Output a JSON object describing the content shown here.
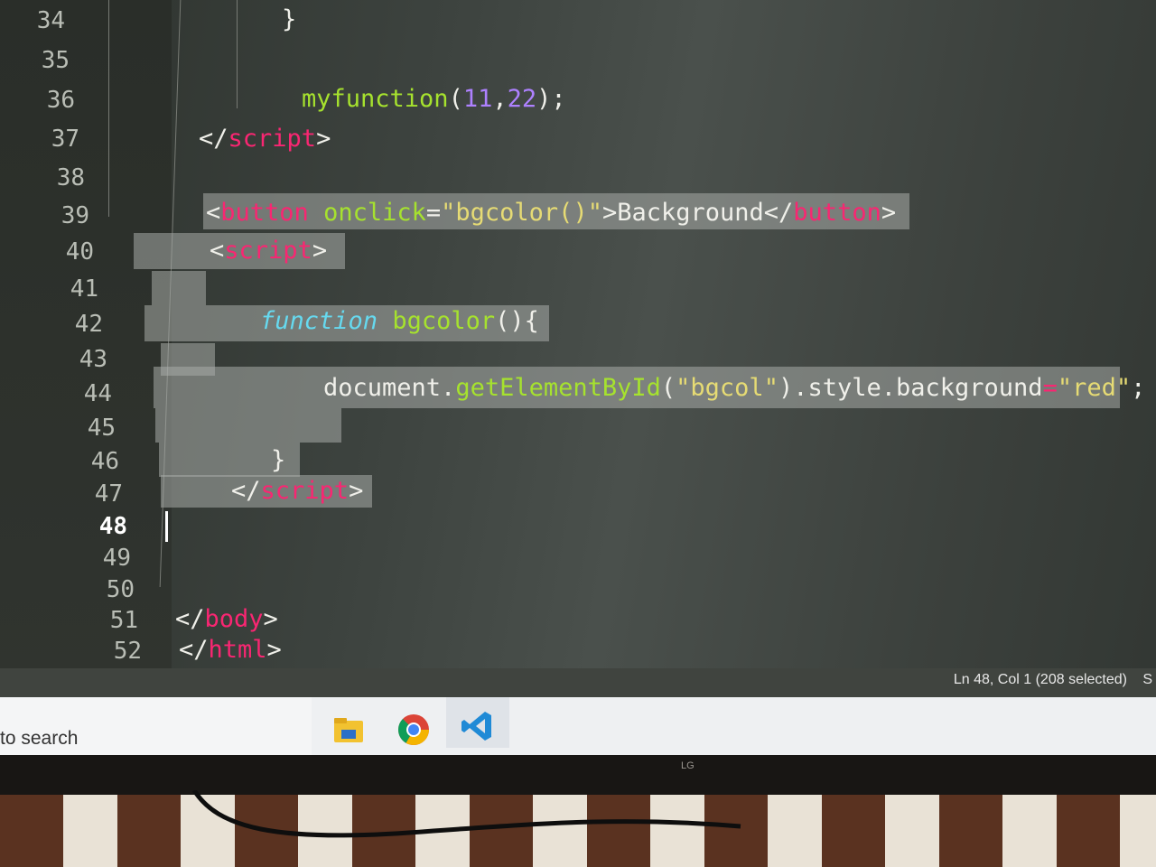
{
  "editor": {
    "line_numbers": [
      "34",
      "35",
      "36",
      "37",
      "38",
      "39",
      "40",
      "41",
      "42",
      "43",
      "44",
      "45",
      "46",
      "47",
      "48",
      "49",
      "50",
      "51",
      "52"
    ],
    "active_line": "48",
    "lines": {
      "l34": "}",
      "l36_fn": "myfunction",
      "l36_open": "(",
      "l36_a": "11",
      "l36_comma": ",",
      "l36_b": "22",
      "l36_close": ");",
      "l37_open": "</",
      "l37_tag": "script",
      "l37_close": ">",
      "l39_open": "<",
      "l39_tag": "button",
      "l39_attr": "onclick",
      "l39_eq": "=",
      "l39_val": "\"bgcolor()\"",
      "l39_gt": ">",
      "l39_text": "Background",
      "l39_endopen": "</",
      "l39_endtag": "button",
      "l39_endgt": ">",
      "l40_open": "<",
      "l40_tag": "script",
      "l40_gt": ">",
      "l42_kw": "function",
      "l42_name": "bgcolor",
      "l42_rest": "(){",
      "l44_obj": "document.",
      "l44_method": "getElementById",
      "l44_p1": "(",
      "l44_arg": "\"bgcol\"",
      "l44_p2": ").style.background",
      "l44_eq": "=",
      "l44_val": "\"red\"",
      "l44_semi": ";",
      "l46": "}",
      "l47_open": "</",
      "l47_tag": "script",
      "l47_gt": ">",
      "l51_open": "</",
      "l51_tag": "body",
      "l51_gt": ">",
      "l52_open": "</",
      "l52_tag": "html",
      "l52_gt": ">"
    }
  },
  "statusbar": {
    "position": "Ln 48, Col 1 (208 selected)",
    "extra": "S"
  },
  "taskbar": {
    "search_text": "to search",
    "icons": [
      "file-explorer-icon",
      "chrome-icon",
      "vscode-icon"
    ]
  },
  "monitor": {
    "brand": "LG"
  },
  "colors": {
    "tag": "#f92672",
    "attribute": "#a6e22e",
    "string": "#e6db74",
    "keyword": "#66d9ef",
    "number": "#ae81ff",
    "selection": "#a8aca8"
  }
}
